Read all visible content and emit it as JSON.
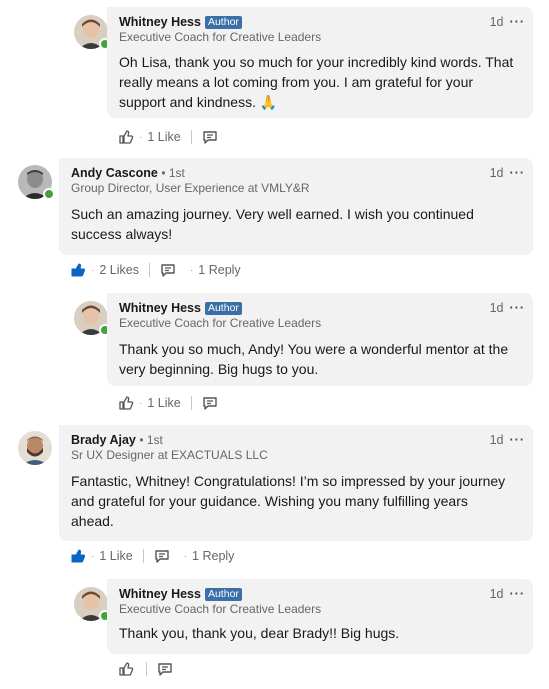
{
  "comments": [
    {
      "name": "Whitney Hess",
      "badge": "Author",
      "degree": "",
      "headline": "Executive Coach for Creative Leaders",
      "time": "1d",
      "more": "···",
      "text": "Oh Lisa, thank you so much for your incredibly kind words. That really means a lot coming from you. I am grateful for your support and kindness. 🙏",
      "likes": "1 Like",
      "replies": ""
    },
    {
      "name": "Andy Cascone",
      "badge": "",
      "degree": "• 1st",
      "headline": "Group Director, User Experience at VMLY&R",
      "time": "1d",
      "more": "···",
      "text": "Such an amazing journey.  Very well earned. I wish you continued success always!",
      "likes": "2 Likes",
      "replies": "1 Reply"
    },
    {
      "name": "Whitney Hess",
      "badge": "Author",
      "degree": "",
      "headline": "Executive Coach for Creative Leaders",
      "time": "1d",
      "more": "···",
      "text": "Thank you so much, Andy! You were a wonderful mentor at the very beginning. Big hugs to you.",
      "likes": "1 Like",
      "replies": ""
    },
    {
      "name": "Brady Ajay",
      "badge": "",
      "degree": "• 1st",
      "headline": "Sr UX Designer at EXACTUALS LLC",
      "time": "1d",
      "more": "···",
      "text": "Fantastic, Whitney! Congratulations! I’m so impressed by your journey and grateful for your guidance. Wishing you many fulfilling years ahead.",
      "likes": "1 Like",
      "replies": "1 Reply"
    },
    {
      "name": "Whitney Hess",
      "badge": "Author",
      "degree": "",
      "headline": "Executive Coach for Creative Leaders",
      "time": "1d",
      "more": "···",
      "text": "Thank you, thank you, dear Brady!! Big hugs.",
      "likes": "",
      "replies": ""
    }
  ],
  "colors": {
    "like_active": "#0a66c2",
    "badge": "#3b6fa8",
    "online": "#44a23c",
    "bubble": "#f2f2f2"
  },
  "icons": {
    "like": "thumbs-up-icon",
    "reply": "comment-icon",
    "more": "more-icon",
    "online": "online-dot-icon"
  }
}
